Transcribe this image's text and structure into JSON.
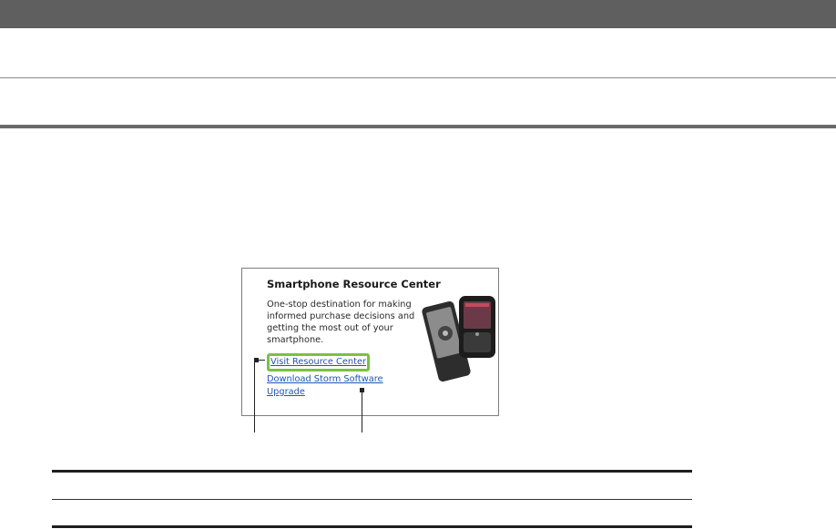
{
  "figure": {
    "card_title": "Smartphone Resource Center",
    "card_description": "One-stop destination for making informed purchase decisions and getting the most out of your smartphone.",
    "link_visit": "Visit Resource Center",
    "link_download": "Download Storm Software Upgrade",
    "highlight_color": "#7ac142",
    "link_color": "#1f56b8",
    "phone_icons": [
      "smartphone-icon",
      "smartphone-icon"
    ]
  },
  "colors": {
    "top_bar": "#5f5f5f",
    "rules": "#6a6a6a"
  }
}
